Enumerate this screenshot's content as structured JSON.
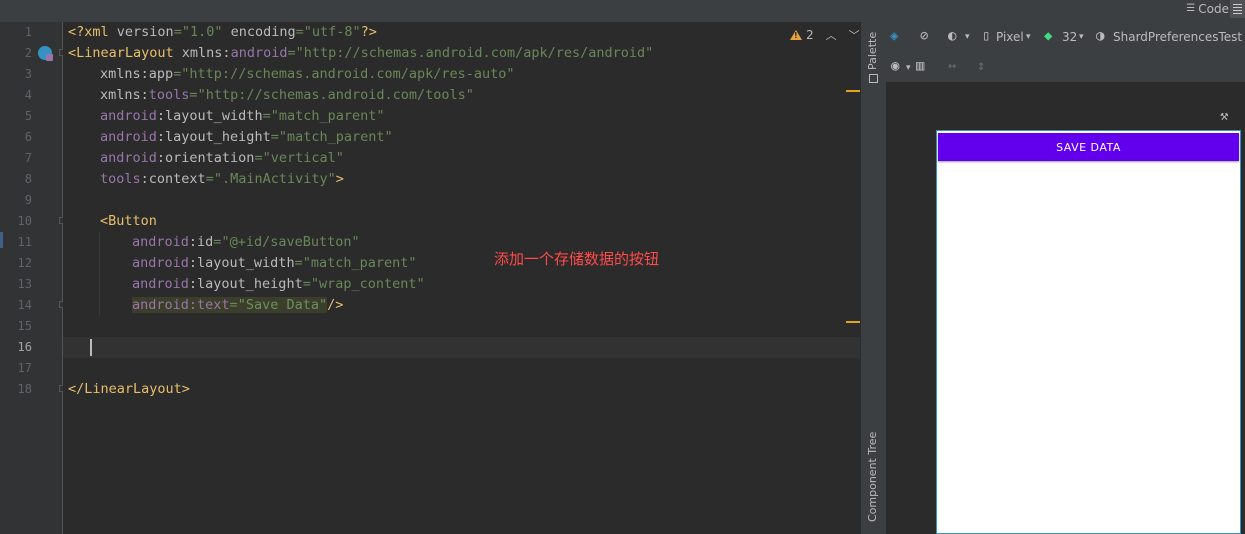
{
  "topbar": {
    "code_label": "Code"
  },
  "editor": {
    "line_numbers": [
      "1",
      "2",
      "3",
      "4",
      "5",
      "6",
      "7",
      "8",
      "9",
      "10",
      "11",
      "12",
      "13",
      "14",
      "15",
      "16",
      "17",
      "18"
    ],
    "current_line": "16",
    "warnings": {
      "count": "2"
    },
    "annotation": "添加一个存储数据的按钮",
    "lines": {
      "l1": {
        "a": "<?xml ",
        "b": "version",
        "c": "=",
        "d": "\"1.0\"",
        "e": " encoding",
        "f": "=",
        "g": "\"utf-8\"",
        "h": "?>"
      },
      "l2": {
        "a": "<LinearLayout ",
        "b": "xmlns:",
        "c": "android",
        "d": "=",
        "e": "\"http://schemas.android.com/apk/res/android\""
      },
      "l3": {
        "a": "xmlns:app",
        "b": "=",
        "c": "\"http://schemas.android.com/apk/res-auto\""
      },
      "l4": {
        "a": "xmlns:",
        "b": "tools",
        "c": "=",
        "d": "\"http://schemas.android.com/tools\""
      },
      "l5": {
        "a": "android",
        "b": ":layout_width",
        "c": "=",
        "d": "\"match_parent\""
      },
      "l6": {
        "a": "android",
        "b": ":layout_height",
        "c": "=",
        "d": "\"match_parent\""
      },
      "l7": {
        "a": "android",
        "b": ":orientation",
        "c": "=",
        "d": "\"vertical\""
      },
      "l8": {
        "a": "tools",
        "b": ":context",
        "c": "=",
        "d": "\".MainActivity\"",
        "e": ">"
      },
      "l10": {
        "a": "<Button"
      },
      "l11": {
        "a": "android",
        "b": ":id",
        "c": "=",
        "d": "\"@+id/saveButton\""
      },
      "l12": {
        "a": "android",
        "b": ":layout_width",
        "c": "=",
        "d": "\"match_parent\""
      },
      "l13": {
        "a": "android",
        "b": ":layout_height",
        "c": "=",
        "d": "\"wrap_content\""
      },
      "l14": {
        "a": "android",
        "b": ":text",
        "c": "=",
        "d": "\"Save Data\"",
        "e": "/>"
      },
      "l18": {
        "a": "</LinearLayout>"
      }
    }
  },
  "side_strip": {
    "palette": "Palette",
    "component_tree": "Component Tree"
  },
  "design": {
    "device": "Pixel",
    "api": "32",
    "theme": "ShardPreferencesTest",
    "preview_button": "SAVE DATA"
  },
  "colors": {
    "accent": "#6200ee",
    "selection": "#3592c4",
    "warning": "#e6a23c",
    "annotation": "#ff4a4a"
  }
}
